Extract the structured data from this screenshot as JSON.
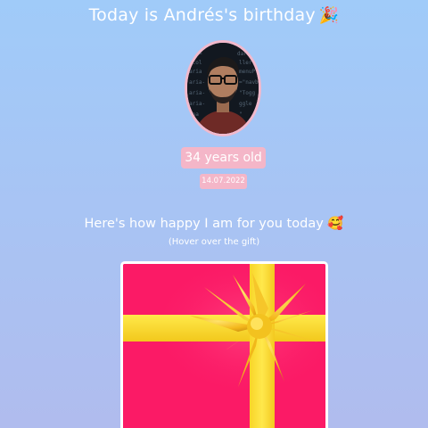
{
  "header": {
    "title": "Today is Andrés's birthday",
    "title_icon": "party-popper-icon"
  },
  "profile": {
    "age_text": "34 years old",
    "date_text": "14.07.2022",
    "avatar_icon": "profile-photo-avatar"
  },
  "message": {
    "text": "Here's how happy I am for you today",
    "icon": "smiling-face-with-hearts-icon",
    "hint": "(Hover over the gift)"
  },
  "gift": {
    "icon": "gift-box-icon",
    "colors": {
      "box": "#fb1a66",
      "ribbon": "#fde52a",
      "border": "#ffffff",
      "badge": "#f4b6c8"
    }
  }
}
